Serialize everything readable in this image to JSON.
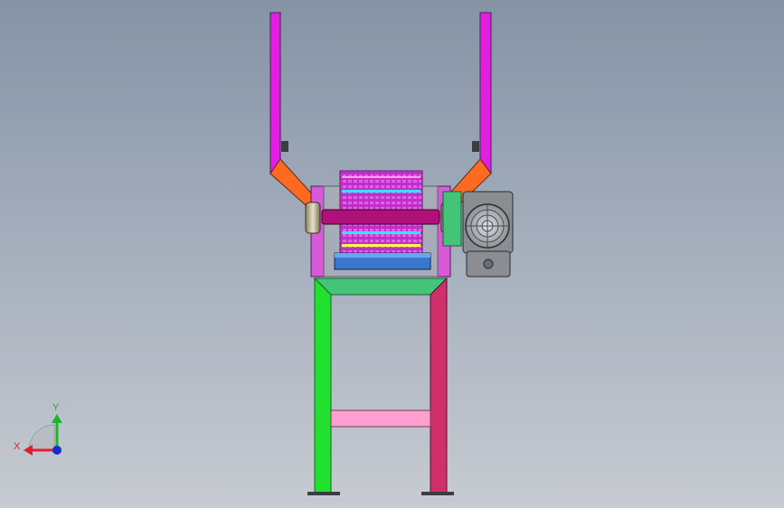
{
  "triad": {
    "x_label": "X",
    "y_label": "Y",
    "x_color": "#e0202a",
    "y_color": "#18b82a",
    "z_color": "#1a2ccc"
  },
  "colors": {
    "background_top": "#8593a6",
    "background_bottom": "#c7cbd1",
    "hopper_arms": "#e020e0",
    "hopper_elbows": "#ff6a20",
    "frame_left_leg": "#22e030",
    "frame_right_leg": "#d0306a",
    "frame_top": "#44c478",
    "frame_crossbar": "#ff9fd0",
    "side_plates": "#d85ad8",
    "rotor_body": "#c030c8",
    "rotor_shaft": "#b0107a",
    "tray": "#3a78d0",
    "motor_body": "#8a8e92",
    "motor_mount": "#44c478"
  },
  "icons": {
    "triad": "coordinate-triad-icon",
    "motor": "motor-fan-cover-icon"
  }
}
